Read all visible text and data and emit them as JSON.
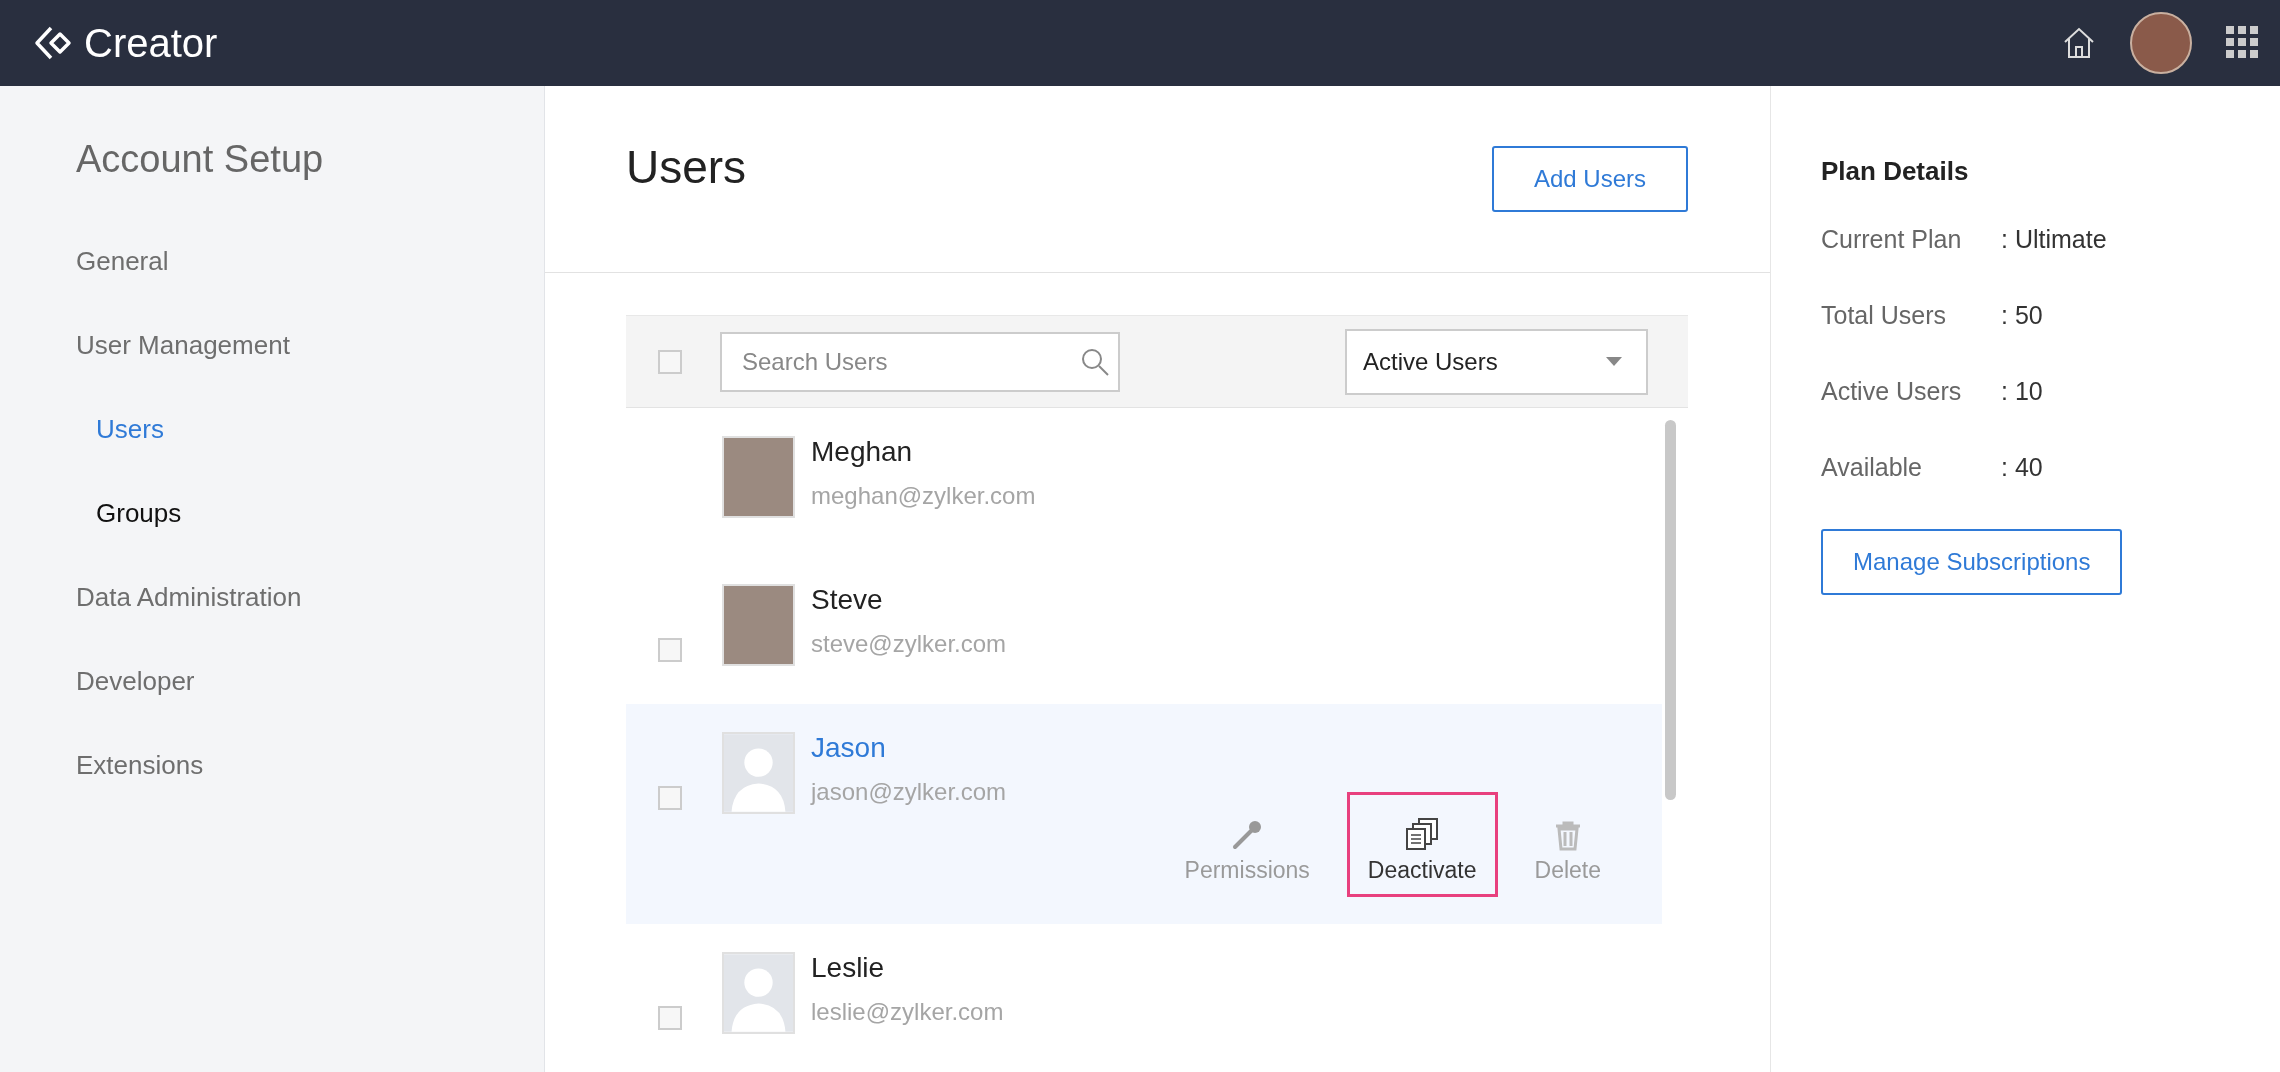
{
  "app": {
    "title": "Creator"
  },
  "sidebar": {
    "title": "Account Setup",
    "items": [
      {
        "label": "General",
        "selected": false
      },
      {
        "label": "User Management",
        "selected": false,
        "children": [
          {
            "label": "Users",
            "selected": true
          },
          {
            "label": "Groups",
            "selected": false
          }
        ]
      },
      {
        "label": "Data Administration",
        "selected": false
      },
      {
        "label": "Developer",
        "selected": false
      },
      {
        "label": "Extensions",
        "selected": false
      }
    ]
  },
  "main": {
    "title": "Users",
    "add_button": "Add Users",
    "search": {
      "placeholder": "Search Users"
    },
    "filter": {
      "value": "Active Users"
    },
    "select_all": {
      "checked": false
    },
    "users": [
      {
        "kind": "photo",
        "name": "Meghan",
        "email": "meghan@zylker.com",
        "highlighted": false
      },
      {
        "kind": "photo",
        "name": "Steve",
        "email": "steve@zylker.com",
        "checked": false,
        "highlighted": false
      },
      {
        "kind": "default",
        "name": "Jason",
        "email": "jason@zylker.com",
        "checked": false,
        "highlighted": true,
        "actions": [
          {
            "kind": "key",
            "label": "Permissions",
            "focused": false
          },
          {
            "kind": "copy",
            "label": "Deactivate",
            "focused": true
          },
          {
            "kind": "trash",
            "label": "Delete",
            "focused": false
          }
        ]
      },
      {
        "kind": "default",
        "name": "Leslie",
        "email": "leslie@zylker.com",
        "checked": false,
        "highlighted": false
      }
    ]
  },
  "plan": {
    "title": "Plan Details",
    "rows": [
      {
        "label": "Current Plan",
        "value": ": Ultimate"
      },
      {
        "label": "Total Users",
        "value": ": 50"
      },
      {
        "label": "Active Users",
        "value": ": 10"
      },
      {
        "label": "Available",
        "value": ": 40"
      }
    ],
    "button": "Manage Subscriptions"
  }
}
